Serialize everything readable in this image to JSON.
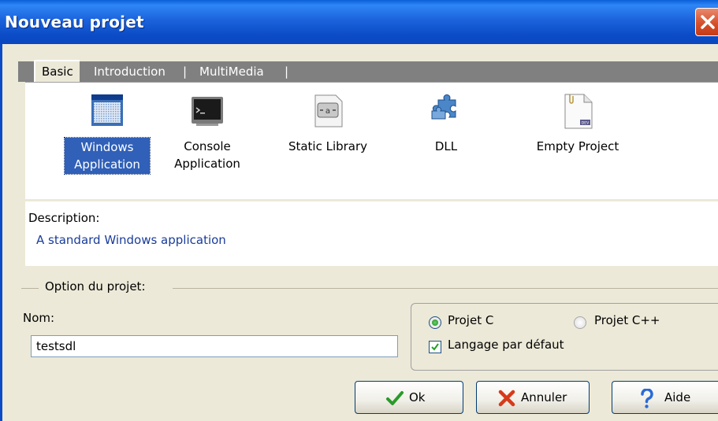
{
  "window": {
    "title": "Nouveau projet"
  },
  "tabs": [
    {
      "label": "Basic",
      "active": true
    },
    {
      "label": "Introduction"
    },
    {
      "label": "|"
    },
    {
      "label": "MultiMedia"
    },
    {
      "label": "|"
    }
  ],
  "project_types": [
    {
      "label_line1": "Windows",
      "label_line2": "Application",
      "icon": "windows-application-icon",
      "selected": true
    },
    {
      "label_line1": "Console",
      "label_line2": "Application",
      "icon": "console-icon"
    },
    {
      "label_line1": "Static Library",
      "label_line2": "",
      "icon": "static-library-icon"
    },
    {
      "label_line1": "DLL",
      "label_line2": "",
      "icon": "dll-puzzle-icon"
    },
    {
      "label_line1": "Empty Project",
      "label_line2": "",
      "icon": "empty-project-icon"
    }
  ],
  "description": {
    "label": "Description:",
    "text": "A standard Windows application"
  },
  "options": {
    "group_label": "Option du projet:",
    "name_label": "Nom:",
    "name_value": "testsdl",
    "radio_c": {
      "label": "Projet C",
      "checked": true
    },
    "radio_cpp": {
      "label": "Projet C++",
      "checked": false
    },
    "default_lang": {
      "label": "Langage par défaut",
      "checked": true
    }
  },
  "buttons": {
    "ok": "Ok",
    "cancel": "Annuler",
    "help": "Aide"
  },
  "colors": {
    "titlebar": "#0b4cc6",
    "selection": "#3060b8",
    "description_text": "#1a3c9a"
  }
}
